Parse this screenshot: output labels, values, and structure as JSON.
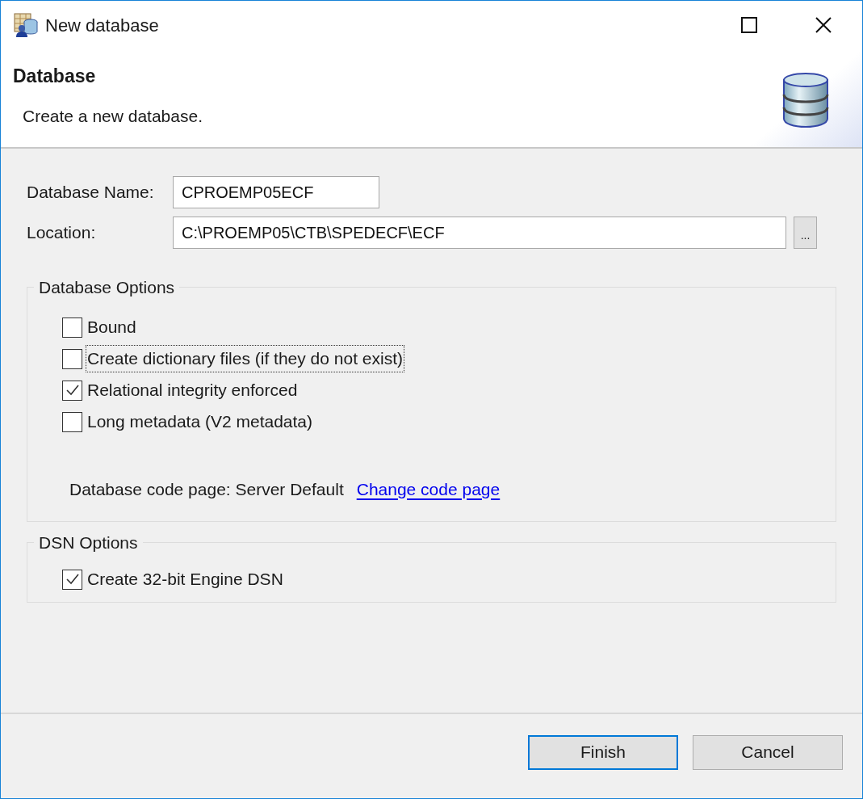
{
  "window": {
    "title": "New database"
  },
  "header": {
    "title": "Database",
    "description": "Create a new database."
  },
  "fields": [
    {
      "label": "Database Name:",
      "value": "CPROEMP05ECF",
      "kind": "short"
    },
    {
      "label": "Location:",
      "value": "C:\\PROEMP05\\CTB\\SPEDECF\\ECF",
      "kind": "browse",
      "browse_label": "..."
    }
  ],
  "database_options": {
    "title": "Database Options",
    "checkboxes": [
      {
        "label": "Bound",
        "checked": false,
        "focused": false
      },
      {
        "label": "Create dictionary files (if they do not exist)",
        "checked": false,
        "focused": true
      },
      {
        "label": "Relational integrity enforced",
        "checked": true,
        "focused": false
      },
      {
        "label": "Long metadata (V2 metadata)",
        "checked": false,
        "focused": false
      }
    ],
    "code_page_text": "Database code page: Server Default",
    "code_page_link": "Change code page"
  },
  "dsn_options": {
    "title": "DSN Options",
    "checkboxes": [
      {
        "label": "Create 32-bit Engine DSN",
        "checked": true,
        "focused": false
      }
    ]
  },
  "buttons": [
    {
      "label": "Finish",
      "default": true
    },
    {
      "label": "Cancel",
      "default": false
    }
  ]
}
